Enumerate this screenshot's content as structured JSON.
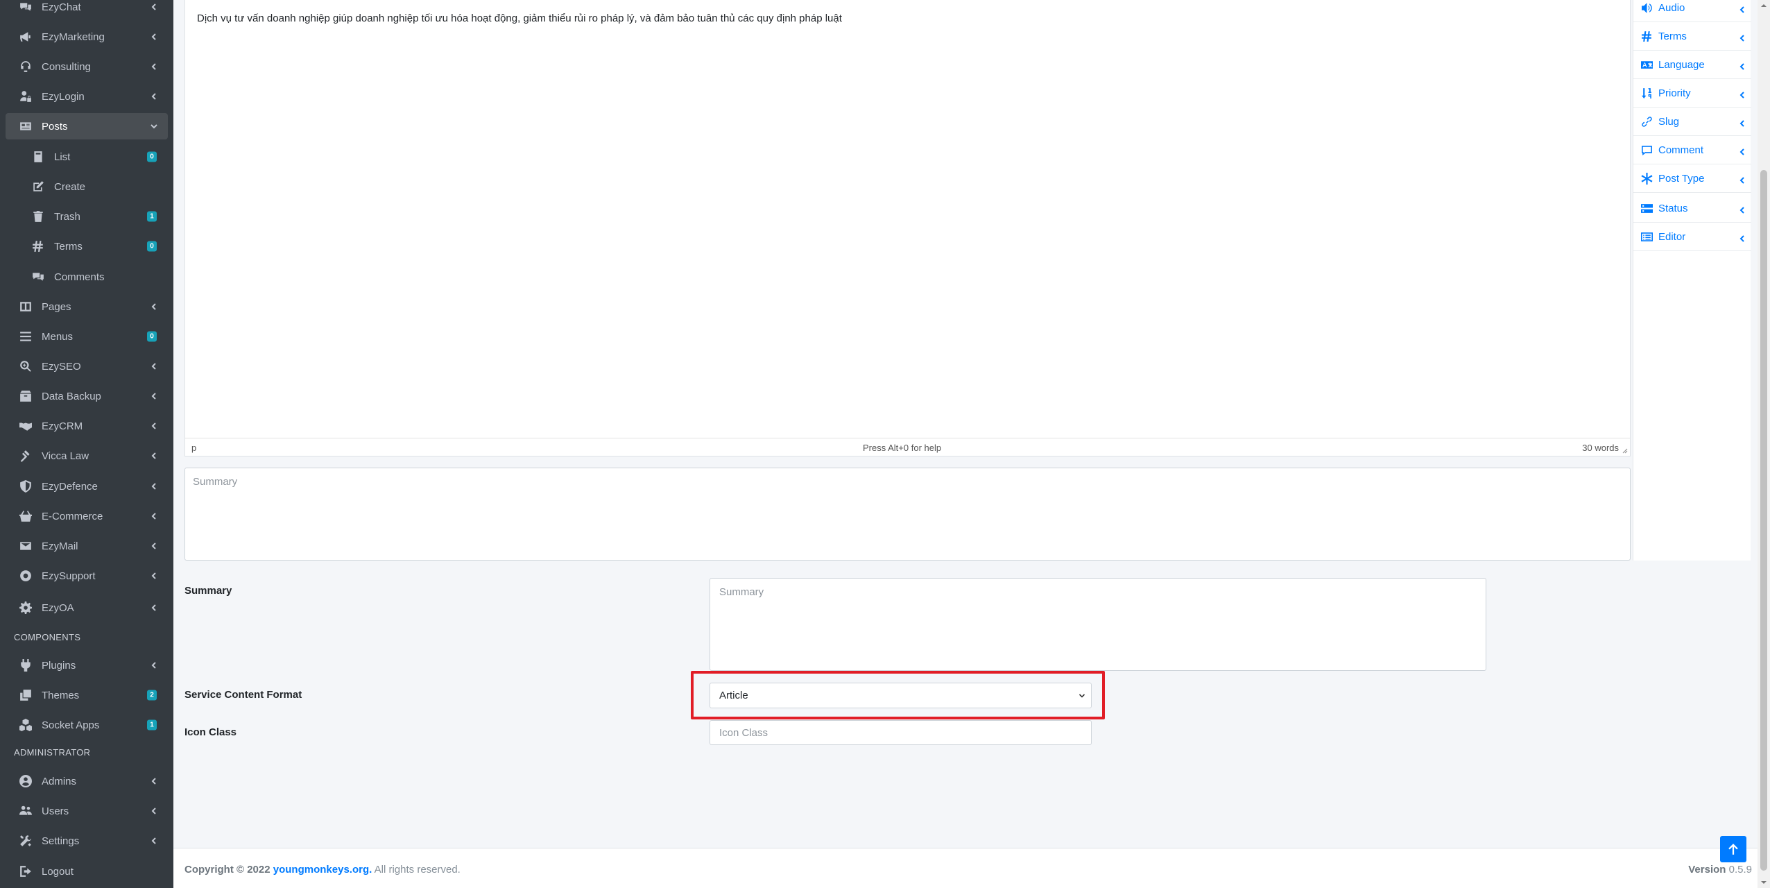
{
  "sidebar": {
    "items": [
      {
        "label": "EzyChat",
        "icon": "comments-icon",
        "expandable": true
      },
      {
        "label": "EzyMarketing",
        "icon": "bullhorn-icon",
        "expandable": true
      },
      {
        "label": "Consulting",
        "icon": "headset-icon",
        "expandable": true
      },
      {
        "label": "EzyLogin",
        "icon": "user-lock-icon",
        "expandable": true
      },
      {
        "label": "Posts",
        "icon": "newspaper-icon",
        "expandable": true,
        "active": true
      },
      {
        "label": "List",
        "icon": "book-icon",
        "badge": "0"
      },
      {
        "label": "Create",
        "icon": "edit-icon"
      },
      {
        "label": "Trash",
        "icon": "trash-icon",
        "badge": "1"
      },
      {
        "label": "Terms",
        "icon": "hashtag-icon",
        "badge": "0"
      },
      {
        "label": "Comments",
        "icon": "comments-icon"
      },
      {
        "label": "Pages",
        "icon": "columns-icon",
        "expandable": true
      },
      {
        "label": "Menus",
        "icon": "bars-icon",
        "badge": "0"
      },
      {
        "label": "EzySEO",
        "icon": "search-plus-icon",
        "expandable": true
      },
      {
        "label": "Data Backup",
        "icon": "box-icon",
        "expandable": true
      },
      {
        "label": "EzyCRM",
        "icon": "handshake-icon",
        "expandable": true
      },
      {
        "label": "Vicca Law",
        "icon": "gavel-icon",
        "expandable": true
      },
      {
        "label": "EzyDefence",
        "icon": "shield-icon",
        "expandable": true
      },
      {
        "label": "E-Commerce",
        "icon": "basket-icon",
        "expandable": true
      },
      {
        "label": "EzyMail",
        "icon": "envelope-icon",
        "expandable": true
      },
      {
        "label": "EzySupport",
        "icon": "life-ring-icon",
        "expandable": true
      },
      {
        "label": "EzyOA",
        "icon": "cog-icon",
        "expandable": true
      }
    ],
    "components_header": "COMPONENTS",
    "components": [
      {
        "label": "Plugins",
        "icon": "plug-icon",
        "expandable": true
      },
      {
        "label": "Themes",
        "icon": "copy-icon",
        "badge": "2"
      },
      {
        "label": "Socket Apps",
        "icon": "cubes-icon",
        "badge": "1"
      }
    ],
    "admin_header": "ADMINISTRATOR",
    "admin": [
      {
        "label": "Admins",
        "icon": "user-circle-icon",
        "expandable": true
      },
      {
        "label": "Users",
        "icon": "users-icon",
        "expandable": true
      },
      {
        "label": "Settings",
        "icon": "tools-icon",
        "expandable": true
      },
      {
        "label": "Logout",
        "icon": "sign-out-icon"
      }
    ]
  },
  "editor": {
    "content": "Dịch vụ tư vấn doanh nghiệp giúp doanh nghiệp tối ưu hóa hoạt động, giảm thiểu rủi ro pháp lý, và đảm bảo tuân thủ các quy định pháp luật",
    "status_path": "p",
    "status_help": "Press Alt+0 for help",
    "word_count": "30 words"
  },
  "summary_placeholder": "Summary",
  "form": {
    "summary_label": "Summary",
    "summary_placeholder": "Summary",
    "format_label": "Service Content Format",
    "format_value": "Article",
    "icon_class_label": "Icon Class",
    "icon_class_placeholder": "Icon Class"
  },
  "right_panel": [
    {
      "label": "Audio",
      "icon": "volume-icon"
    },
    {
      "label": "Terms",
      "icon": "hashtag-icon"
    },
    {
      "label": "Language",
      "icon": "language-icon"
    },
    {
      "label": "Priority",
      "icon": "sort-numeric-icon"
    },
    {
      "label": "Slug",
      "icon": "link-icon"
    },
    {
      "label": "Comment",
      "icon": "comment-icon"
    },
    {
      "label": "Post Type",
      "icon": "asterisk-icon"
    },
    {
      "label": "Status",
      "icon": "toggle-icon"
    },
    {
      "label": "Editor",
      "icon": "list-alt-icon"
    }
  ],
  "footer": {
    "copyright_prefix": "Copyright © 2022",
    "copyright_link": "youngmonkeys.org.",
    "copyright_suffix": "All rights reserved.",
    "version_label": "Version",
    "version_value": "0.5.9"
  },
  "colors": {
    "sidebar_bg": "#343a40",
    "accent": "#007bff",
    "badge": "#17a2b8",
    "highlight": "#e11d26"
  }
}
